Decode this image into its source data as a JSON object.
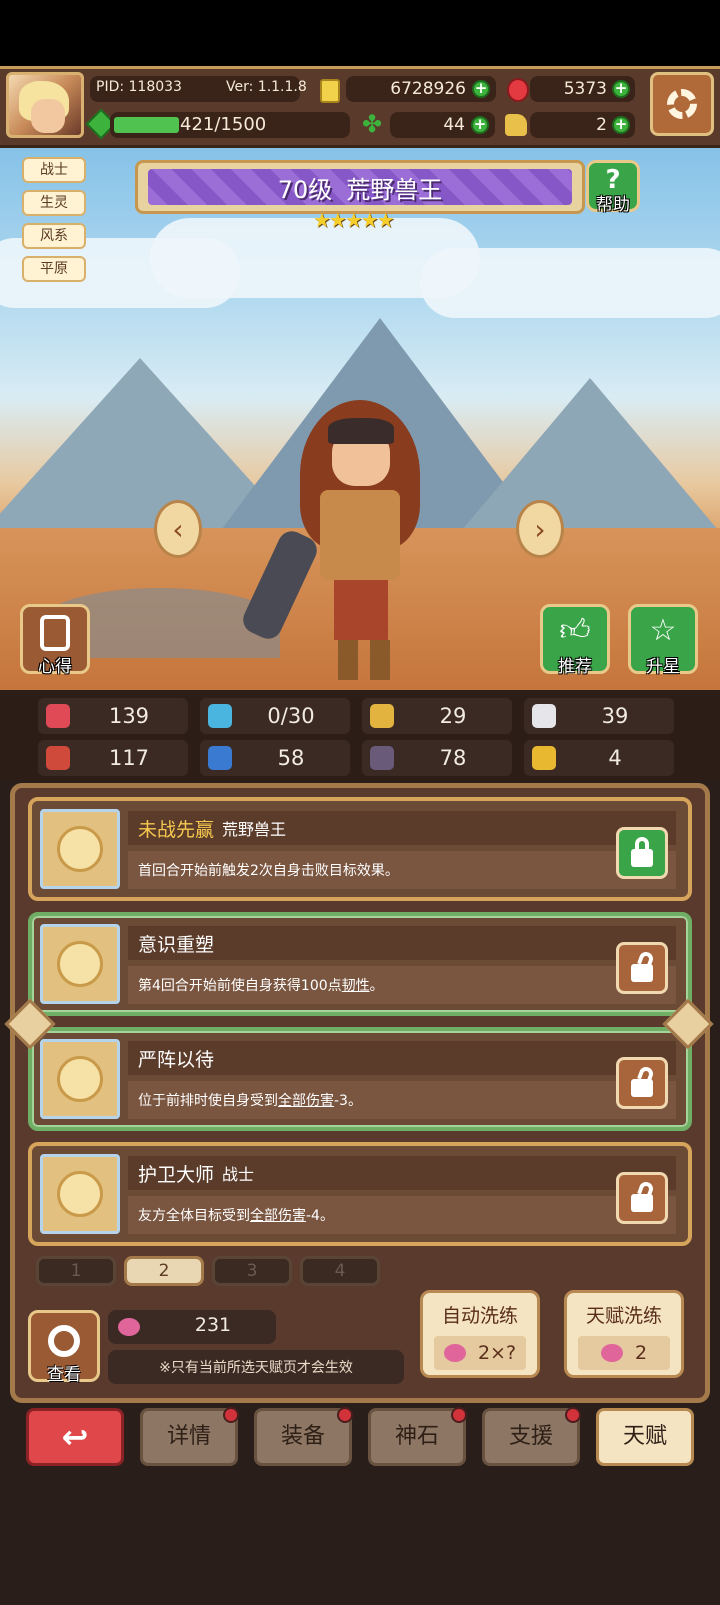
{
  "hud": {
    "pid": "PID: 118033",
    "version": "Ver: 1.1.1.8",
    "gold": "6728926",
    "gems": "5373",
    "exp": "421/1500",
    "exp_fraction": 0.28,
    "clover": "44",
    "shoe": "2"
  },
  "tags": [
    "战士",
    "生灵",
    "风系",
    "平原"
  ],
  "hero": {
    "title_level": "70级",
    "title_name": "荒野兽王",
    "stars": 5,
    "stars_text": "★★★★★"
  },
  "buttons": {
    "help": "帮助",
    "notes": "心得",
    "recommend": "推荐",
    "upgrade_star": "升星"
  },
  "stats": [
    {
      "icon": "heart-icon",
      "value": "139",
      "color": "#e04a56"
    },
    {
      "icon": "mana-drop-icon",
      "value": "0/30",
      "color": "#4ab6e0"
    },
    {
      "icon": "shield-icon",
      "value": "29",
      "color": "#e3b340"
    },
    {
      "icon": "wing-icon",
      "value": "39",
      "color": "#e6e6ea"
    },
    {
      "icon": "fist-icon",
      "value": "117",
      "color": "#d04a3c"
    },
    {
      "icon": "book-icon",
      "value": "58",
      "color": "#3a7ad0"
    },
    {
      "icon": "boot-icon",
      "value": "78",
      "color": "#6a5a7a"
    },
    {
      "icon": "horseshoe-icon",
      "value": "4",
      "color": "#e8b830"
    }
  ],
  "talents": [
    {
      "name": "未战先赢",
      "sub": "荒野兽王",
      "desc": "首回合开始前触发2次自身击败目标效果。",
      "desc_pre": "首回合开始前触发2次自身击败目标效果。",
      "desc_link": "",
      "desc_post": "",
      "state": "locked"
    },
    {
      "name": "意识重塑",
      "sub": "",
      "desc": "第4回合开始前使自身获得100点韧性。",
      "desc_pre": "第4回合开始前使自身获得100点",
      "desc_link": "韧性",
      "desc_post": "。",
      "state": "open"
    },
    {
      "name": "严阵以待",
      "sub": "",
      "desc": "位于前排时使自身受到全部伤害-3。",
      "desc_pre": "位于前排时使自身受到",
      "desc_link": "全部伤害",
      "desc_post": "-3。",
      "state": "open"
    },
    {
      "name": "护卫大师",
      "sub": "战士",
      "desc": "友方全体目标受到全部伤害-4。",
      "desc_pre": "友方全体目标受到",
      "desc_link": "全部伤害",
      "desc_post": "-4。",
      "state": "open"
    }
  ],
  "pages": [
    "1",
    "2",
    "3",
    "4"
  ],
  "active_page": "2",
  "resource": {
    "value": "231"
  },
  "view_label": "查看",
  "note": "※只有当前所选天赋页才会生效",
  "auto_refine": {
    "title": "自动洗练",
    "cost": "2×?"
  },
  "talent_refine": {
    "title": "天赋洗练",
    "cost": "2"
  },
  "nav": [
    "详情",
    "装备",
    "神石",
    "支援",
    "天赋"
  ]
}
